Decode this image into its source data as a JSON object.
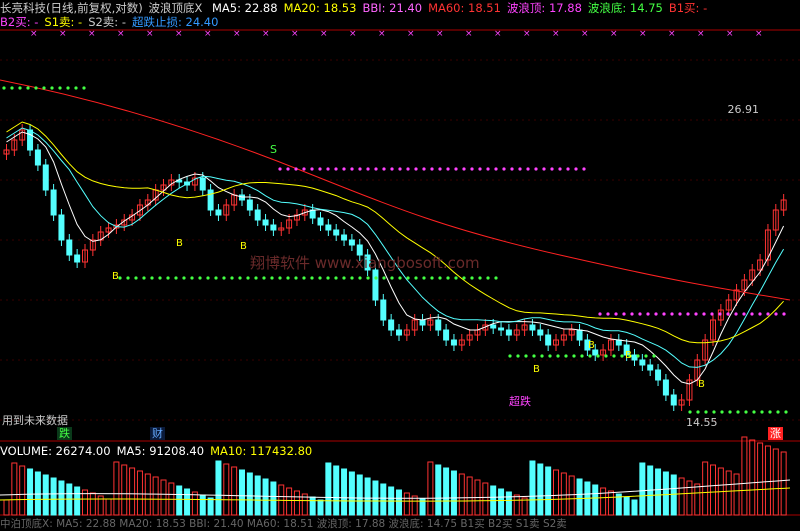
{
  "header": {
    "title": "长亮科技(日线,前复权,对数)",
    "indicator": "波浪顶底X",
    "items": [
      {
        "label": "MA5:",
        "value": "22.88",
        "color": "#ffffff"
      },
      {
        "label": "MA20:",
        "value": "18.53",
        "color": "#ffff00"
      },
      {
        "label": "BBI:",
        "value": "21.40",
        "color": "#ff66ff"
      },
      {
        "label": "MA60:",
        "value": "18.51",
        "color": "#ff3333"
      },
      {
        "label": "波浪顶:",
        "value": "17.88",
        "color": "#ff44ff"
      },
      {
        "label": "波浪底:",
        "value": "14.75",
        "color": "#44ff44"
      },
      {
        "label": "B1买:",
        "value": "-",
        "color": "#ff3333"
      }
    ]
  },
  "header2": {
    "items": [
      {
        "label": "B2买:",
        "value": "-",
        "color": "#ff44ff"
      },
      {
        "label": "S1卖:",
        "value": "-",
        "color": "#ffff00"
      },
      {
        "label": "S2卖:",
        "value": "-",
        "color": "#cccccc"
      },
      {
        "label": "超跌止损:",
        "value": "24.40",
        "color": "#3399ff"
      }
    ]
  },
  "annotations": {
    "price_high": "26.91",
    "price_low": "14.55",
    "s_marker": "S",
    "chaodie": "超跌",
    "future_data": "用到未来数据",
    "die": "跌",
    "cai": "财",
    "zhang": "涨",
    "watermark": "翔博软件 www.xiangbosoft.com",
    "b_marker": "B"
  },
  "volume": {
    "items": [
      {
        "label": "VOLUME:",
        "value": "26274.00",
        "color": "#ffffff"
      },
      {
        "label": "MA5:",
        "value": "91208.40",
        "color": "#ffffff"
      },
      {
        "label": "MA10:",
        "value": "117432.80",
        "color": "#ffff00"
      }
    ]
  },
  "footer": {
    "text": "中泊顶底X: MA5: 22.88  MA20: 18.53  BBI: 21.40  MA60: 18.51  波浪顶: 17.88  波浪底: 14.75  B1买  B2买  S1卖  S2卖"
  },
  "colors": {
    "up": "#ff3333",
    "down": "#54ffff",
    "ma5": "#ffffff",
    "ma20": "#ffff00",
    "bbi": "#ff66ff",
    "ma60": "#ff2222",
    "top": "#ff44ff",
    "bottom": "#44ff44"
  }
}
